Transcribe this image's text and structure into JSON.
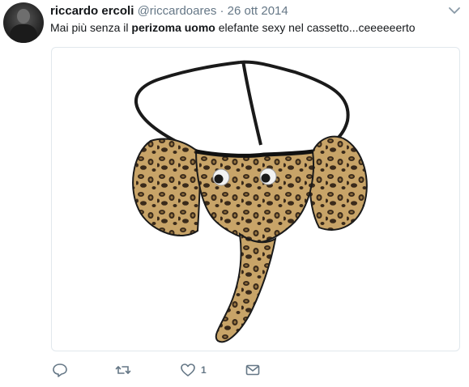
{
  "tweet": {
    "author_name": "riccardo ercoli",
    "author_handle": "@riccardoares",
    "separator": "·",
    "date": "26 ott 2014",
    "text_before": "Mai più senza il ",
    "text_bold": "perizoma uomo",
    "text_after": " elefante sexy nel cassetto...ceeeeeerto",
    "like_count": "1"
  },
  "icons": {
    "avatar": "profile-photo",
    "menu": "chevron-down-icon",
    "reply": "reply-icon",
    "retweet": "retweet-icon",
    "like": "heart-icon",
    "dm": "envelope-icon"
  },
  "colors": {
    "text": "#14171a",
    "secondary": "#657786",
    "border": "#e1e8ed",
    "leopard_base": "#c8a468",
    "leopard_spot": "#3a2a1a"
  }
}
